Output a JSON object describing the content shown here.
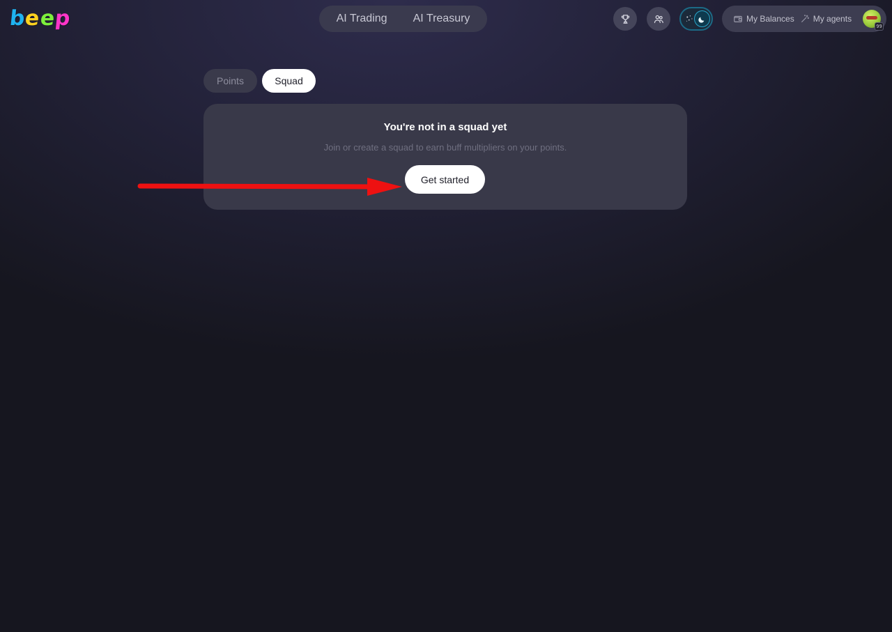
{
  "logo": {
    "letters": [
      {
        "char": "b",
        "color": "#1fb3f0"
      },
      {
        "char": "e",
        "color": "#ffd21f"
      },
      {
        "char": "e",
        "color": "#7df03c"
      },
      {
        "char": "p",
        "color": "#ff35c8"
      }
    ]
  },
  "nav": {
    "items": [
      "AI Trading",
      "AI Treasury"
    ]
  },
  "header_icons": [
    "trophy-icon",
    "people-icon"
  ],
  "theme_toggle": {
    "mode": "dark",
    "accent": "#2aa5c9"
  },
  "account": {
    "balances_label": "My Balances",
    "agents_label": "My agents",
    "avatar_badge": "99"
  },
  "tabs": {
    "points": "Points",
    "squad": "Squad",
    "active": "Squad"
  },
  "card": {
    "title": "You're not in a squad yet",
    "subtitle": "Join or create a squad to earn buff multipliers on your points.",
    "button_label": "Get started"
  },
  "annotation": {
    "arrow_color": "#ee1111"
  }
}
